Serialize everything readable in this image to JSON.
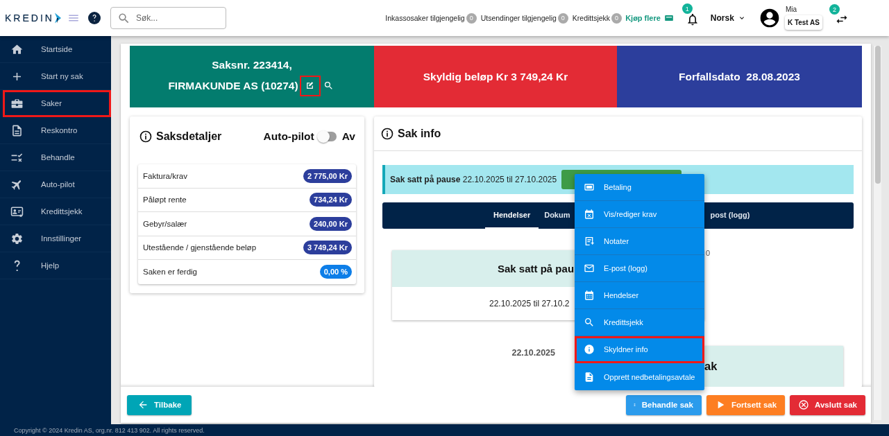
{
  "header": {
    "logo": "KREDIN",
    "search": {
      "placeholder": "Søk..."
    },
    "counters": [
      {
        "label": "Inkassosaker tilgjengelig",
        "count": "0"
      },
      {
        "label": "Utsendinger tilgjengelig",
        "count": "0"
      },
      {
        "label": "Kredittsjekk",
        "count": "0"
      }
    ],
    "buy_link": "Kjøp flere",
    "notifications": {
      "badge": "1"
    },
    "language": "Norsk",
    "user": {
      "name": "Mia",
      "company": "K Test AS"
    },
    "switch": {
      "badge": "2"
    }
  },
  "sidebar": {
    "items": [
      {
        "label": "Startside",
        "highlighted": false
      },
      {
        "label": "Start ny sak",
        "highlighted": false
      },
      {
        "label": "Saker",
        "highlighted": true
      },
      {
        "label": "Reskontro",
        "highlighted": false
      },
      {
        "label": "Behandle",
        "highlighted": false
      },
      {
        "label": "Auto-pilot",
        "highlighted": false
      },
      {
        "label": "Kredittsjekk",
        "highlighted": false
      },
      {
        "label": "Innstillinger",
        "highlighted": false
      },
      {
        "label": "Hjelp",
        "highlighted": false
      }
    ]
  },
  "case_banner": {
    "title": "Saksnr. 223414,",
    "customer": "FIRMAKUNDE AS (10274)",
    "edit_highlighted": true
  },
  "amount_banner": {
    "text": "Skyldig beløp Kr 3 749,24 Kr"
  },
  "due_banner": {
    "text": "Forfallsdato  28.08.2023"
  },
  "details": {
    "title": "Saksdetaljer",
    "autopilot": {
      "label": "Auto-pilot",
      "on": false,
      "state_text": "Av"
    },
    "rows": [
      {
        "label": "Faktura/krav",
        "value": "2 775,00 Kr",
        "color": "#2c3e9c"
      },
      {
        "label": "Påløpt rente",
        "value": "734,24 Kr",
        "color": "#2c3e9c"
      },
      {
        "label": "Gebyr/salær",
        "value": "240,00 Kr",
        "color": "#2c3e9c"
      },
      {
        "label": "Utestående / gjenstående beløp",
        "value": "3 749,24 Kr",
        "color": "#2c3e9c"
      },
      {
        "label": "Saken er ferdig",
        "value": "0,00 %",
        "color": "#0d7ee8"
      }
    ]
  },
  "info": {
    "title": "Sak info",
    "alert": "**Sak satt på pause** 22.10.2025 til 27.10.2025",
    "tabs": [
      {
        "label": "Hendelser",
        "selected": true
      },
      {
        "label": "Dokum",
        "selected": false
      },
      {
        "label": "post (logg)",
        "selected": false
      }
    ],
    "timeline": {
      "card_title": "Sak satt på pau",
      "card_text": "22.10.2025 til 27.10.2",
      "side_text": "0",
      "date": "22.10.2025",
      "second_card_title": "ak"
    }
  },
  "menu": {
    "items": [
      {
        "label": "Betaling",
        "highlighted": false
      },
      {
        "label": "Vis/rediger krav",
        "highlighted": false
      },
      {
        "label": "Notater",
        "highlighted": false
      },
      {
        "label": "E-post (logg)",
        "highlighted": false
      },
      {
        "label": "Hendelser",
        "highlighted": false
      },
      {
        "label": "Kredittsjekk",
        "highlighted": false
      },
      {
        "label": "Skyldner info",
        "highlighted": true
      },
      {
        "label": "Opprett nedbetalingsavtale",
        "highlighted": false
      }
    ]
  },
  "actions": {
    "back": "Tilbake",
    "buttons": [
      {
        "label": "Behandle sak",
        "kind": "menu"
      },
      {
        "label": "Fortsett sak",
        "kind": "play"
      },
      {
        "label": "Avslutt sak",
        "kind": "close"
      }
    ]
  },
  "footer": "Copyright © 2024 Kredin AS, org.nr. 812 413 902. All rights reserved."
}
